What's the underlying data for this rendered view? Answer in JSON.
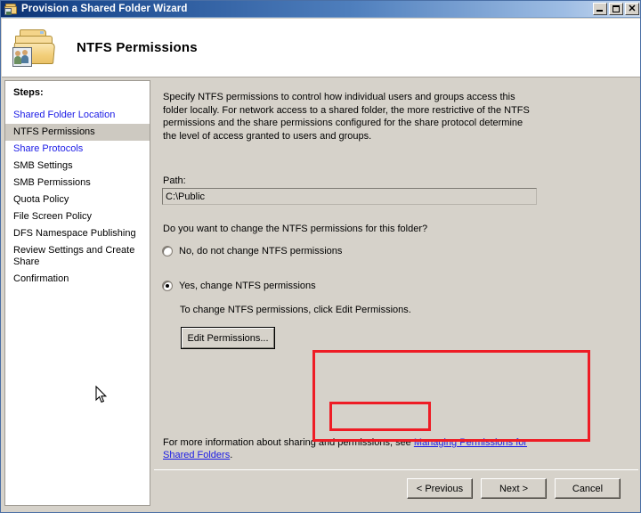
{
  "window": {
    "title": "Provision a Shared Folder Wizard",
    "icon": "folder-users-icon",
    "minimize_label": "_",
    "maximize_label": "",
    "close_label": "✕"
  },
  "header": {
    "title": "NTFS Permissions",
    "icon": "folder-users-large-icon"
  },
  "sidebar": {
    "label": "Steps:",
    "items": [
      {
        "label": "Shared Folder Location",
        "state": "link"
      },
      {
        "label": "NTFS Permissions",
        "state": "current"
      },
      {
        "label": "Share Protocols",
        "state": "link"
      },
      {
        "label": "SMB Settings",
        "state": "normal"
      },
      {
        "label": "SMB Permissions",
        "state": "normal"
      },
      {
        "label": "Quota Policy",
        "state": "normal"
      },
      {
        "label": "File Screen Policy",
        "state": "normal"
      },
      {
        "label": "DFS Namespace Publishing",
        "state": "normal"
      },
      {
        "label": "Review Settings and Create Share",
        "state": "normal"
      },
      {
        "label": "Confirmation",
        "state": "normal"
      }
    ]
  },
  "main": {
    "intro": "Specify NTFS permissions to control how individual users and groups access this folder locally. For network access to a shared folder, the more restrictive of the NTFS permissions and the share permissions configured for the share protocol determine the level of access granted to users and groups.",
    "path_label": "Path:",
    "path_value": "C:\\Public",
    "question": "Do you want to change the NTFS permissions for this folder?",
    "radio_no_label": "No, do not change NTFS permissions",
    "radio_yes_label": "Yes, change NTFS permissions",
    "radio_selected": "yes",
    "edit_hint": "To change NTFS permissions, click Edit Permissions.",
    "edit_button_label": "Edit Permissions...",
    "more_info_prefix": "For more information about sharing and permissions, see ",
    "more_info_link": "Managing Permissions for Shared Folders",
    "more_info_suffix": "."
  },
  "footer": {
    "previous_label": "< Previous",
    "next_label": "Next >",
    "cancel_label": "Cancel"
  },
  "colors": {
    "accent_link": "#1a1ae6",
    "annotation_red": "#ee1c25",
    "panel_background": "#d6d2ca",
    "titlebar_blue": "#1c4a8f"
  }
}
